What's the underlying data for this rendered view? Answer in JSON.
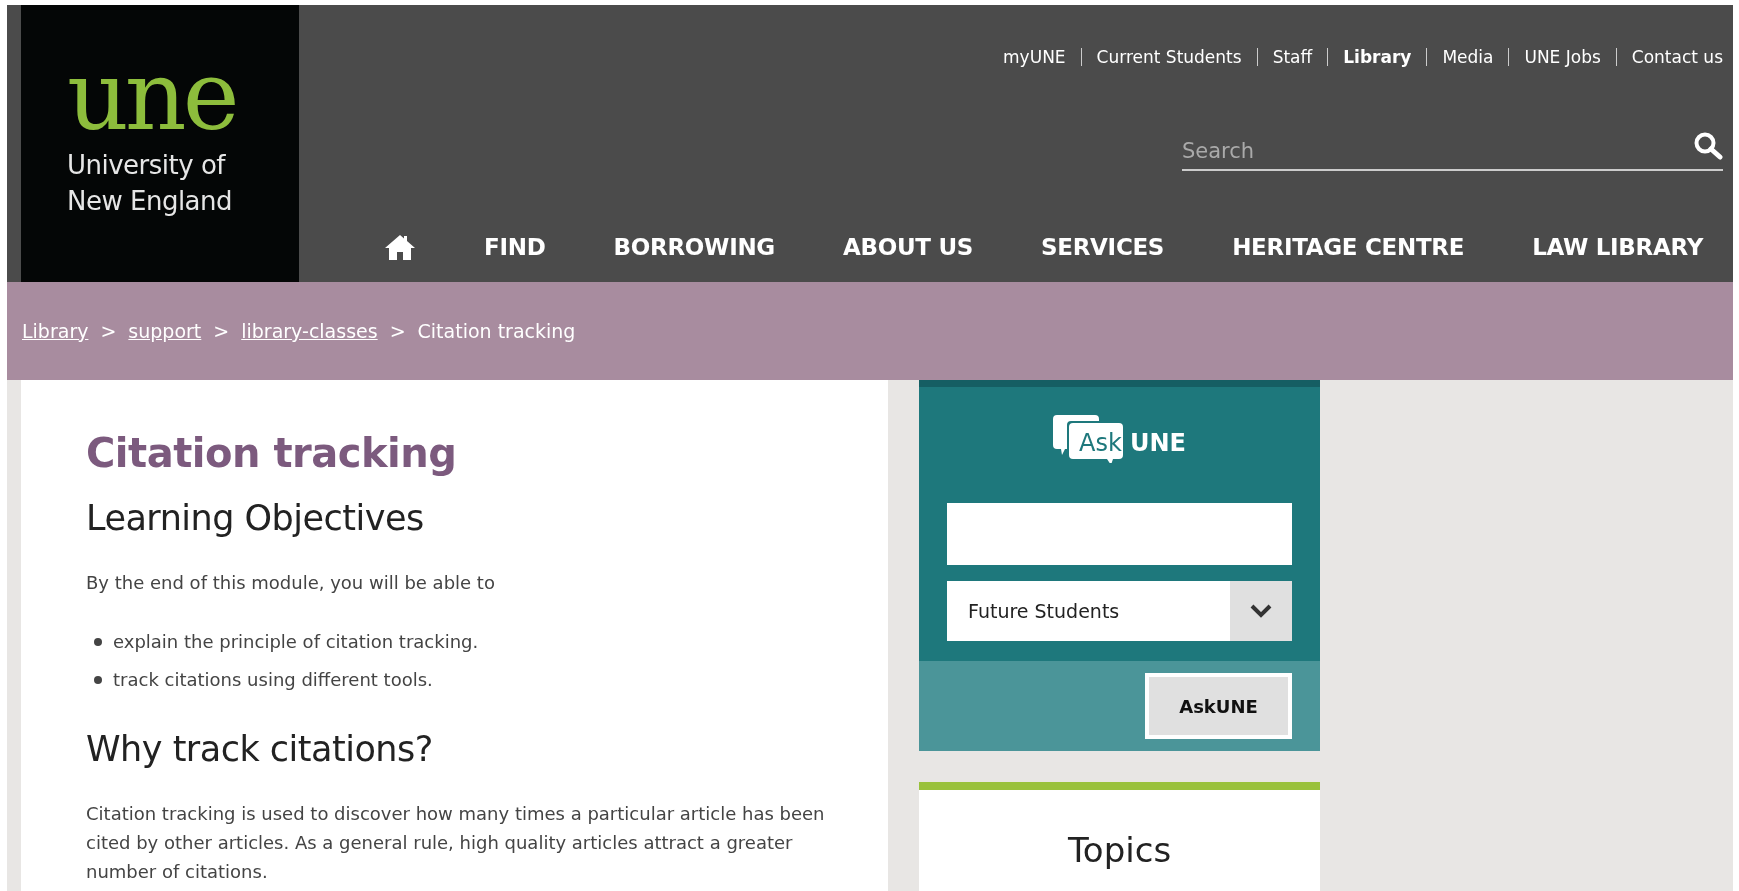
{
  "logo": {
    "mark": "une",
    "name_lines": [
      "University of",
      "New England"
    ]
  },
  "utility_links": [
    {
      "label": "myUNE",
      "selected": false
    },
    {
      "label": "Current Students",
      "selected": false
    },
    {
      "label": "Staff",
      "selected": false
    },
    {
      "label": "Library",
      "selected": true
    },
    {
      "label": "Media",
      "selected": false
    },
    {
      "label": "UNE Jobs",
      "selected": false
    },
    {
      "label": "Contact us",
      "selected": false
    }
  ],
  "search": {
    "placeholder": "Search"
  },
  "main_nav": [
    {
      "kind": "home"
    },
    {
      "kind": "text",
      "label": "FIND"
    },
    {
      "kind": "text",
      "label": "BORROWING"
    },
    {
      "kind": "text",
      "label": "ABOUT US"
    },
    {
      "kind": "text",
      "label": "SERVICES"
    },
    {
      "kind": "text",
      "label": "HERITAGE CENTRE"
    },
    {
      "kind": "text",
      "label": "LAW LIBRARY"
    }
  ],
  "breadcrumb": [
    {
      "label": "Library",
      "kind": "link"
    },
    {
      "label": "support",
      "kind": "link"
    },
    {
      "label": "library-classes",
      "kind": "link"
    },
    {
      "label": "Citation tracking",
      "kind": "current"
    }
  ],
  "breadcrumb_separator": ">",
  "content": {
    "title": "Citation tracking",
    "blocks": [
      {
        "kind": "heading",
        "text": "Learning Objectives"
      },
      {
        "kind": "paragraph",
        "text": "By the end of this module, you will be able to"
      },
      {
        "kind": "list",
        "items": [
          "explain the principle of citation tracking.",
          "track citations using different tools."
        ]
      },
      {
        "kind": "heading",
        "text": "Why track citations?"
      },
      {
        "kind": "paragraph",
        "text": "Citation tracking is used to discover how many times a particular article has been cited by other articles. As a general rule, high quality articles attract a greater number of citations."
      }
    ]
  },
  "ask_widget": {
    "logo_words": [
      "Ask",
      "UNE"
    ],
    "audience": "Future Students",
    "button": "AskUNE"
  },
  "topics": {
    "title": "Topics"
  }
}
